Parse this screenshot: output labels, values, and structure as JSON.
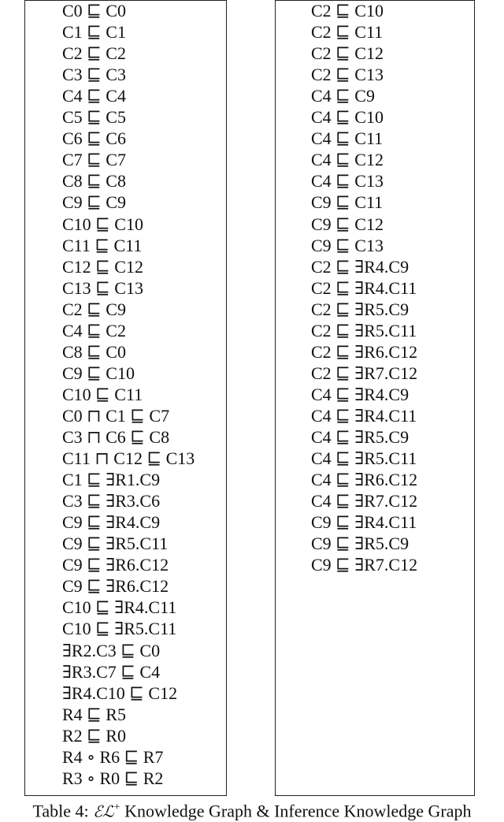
{
  "table": {
    "left_column_label": "EL+ Knowledge Graph",
    "right_column_label": "Inference Knowledge Graph",
    "left": [
      "C0 ⊑ C0",
      "C1 ⊑ C1",
      "C2 ⊑ C2",
      "C3 ⊑ C3",
      "C4 ⊑ C4",
      "C5 ⊑ C5",
      "C6 ⊑ C6",
      "C7 ⊑ C7",
      "C8 ⊑ C8",
      "C9 ⊑ C9",
      "C10 ⊑ C10",
      "C11 ⊑ C11",
      "C12 ⊑ C12",
      "C13 ⊑ C13",
      "C2 ⊑ C9",
      "C4 ⊑ C2",
      "C8 ⊑ C0",
      "C9 ⊑ C10",
      "C10 ⊑ C11",
      "C0 ⊓ C1 ⊑ C7",
      "C3 ⊓ C6 ⊑ C8",
      "C11 ⊓ C12 ⊑ C13",
      "C1 ⊑ ∃R1.C9",
      "C3 ⊑ ∃R3.C6",
      "C9 ⊑ ∃R4.C9",
      "C9 ⊑ ∃R5.C11",
      "C9 ⊑ ∃R6.C12",
      "C9 ⊑ ∃R6.C12",
      "C10 ⊑ ∃R4.C11",
      "C10 ⊑ ∃R5.C11",
      "∃R2.C3 ⊑ C0",
      "∃R3.C7 ⊑ C4",
      "∃R4.C10 ⊑ C12",
      "R4 ⊑ R5",
      "R2 ⊑ R0",
      "R4 ∘ R6 ⊑ R7",
      "R3 ∘ R0 ⊑ R2"
    ],
    "right": [
      "C2 ⊑ C10",
      "C2 ⊑ C11",
      "C2 ⊑ C12",
      "C2 ⊑ C13",
      "C4 ⊑ C9",
      "C4 ⊑ C10",
      "C4 ⊑ C11",
      "C4 ⊑ C12",
      "C4 ⊑ C13",
      "C9 ⊑ C11",
      "C9 ⊑ C12",
      "C9 ⊑ C13",
      "C2 ⊑ ∃R4.C9",
      "C2 ⊑ ∃R4.C11",
      "C2 ⊑ ∃R5.C9",
      "C2 ⊑ ∃R5.C11",
      "C2 ⊑ ∃R6.C12",
      "C2 ⊑ ∃R7.C12",
      "C4 ⊑ ∃R4.C9",
      "C4 ⊑ ∃R4.C11",
      "C4 ⊑ ∃R5.C9",
      "C4 ⊑ ∃R5.C11",
      "C4 ⊑ ∃R6.C12",
      "C4 ⊑ ∃R7.C12",
      "C9 ⊑ ∃R4.C11",
      "C9 ⊑ ∃R5.C9",
      "C9 ⊑ ∃R7.C12"
    ]
  },
  "caption": {
    "prefix": "Table 4: ",
    "logic": "ℰℒ",
    "sup": "+",
    "suffix": " Knowledge Graph & Inference Knowledge Graph"
  }
}
